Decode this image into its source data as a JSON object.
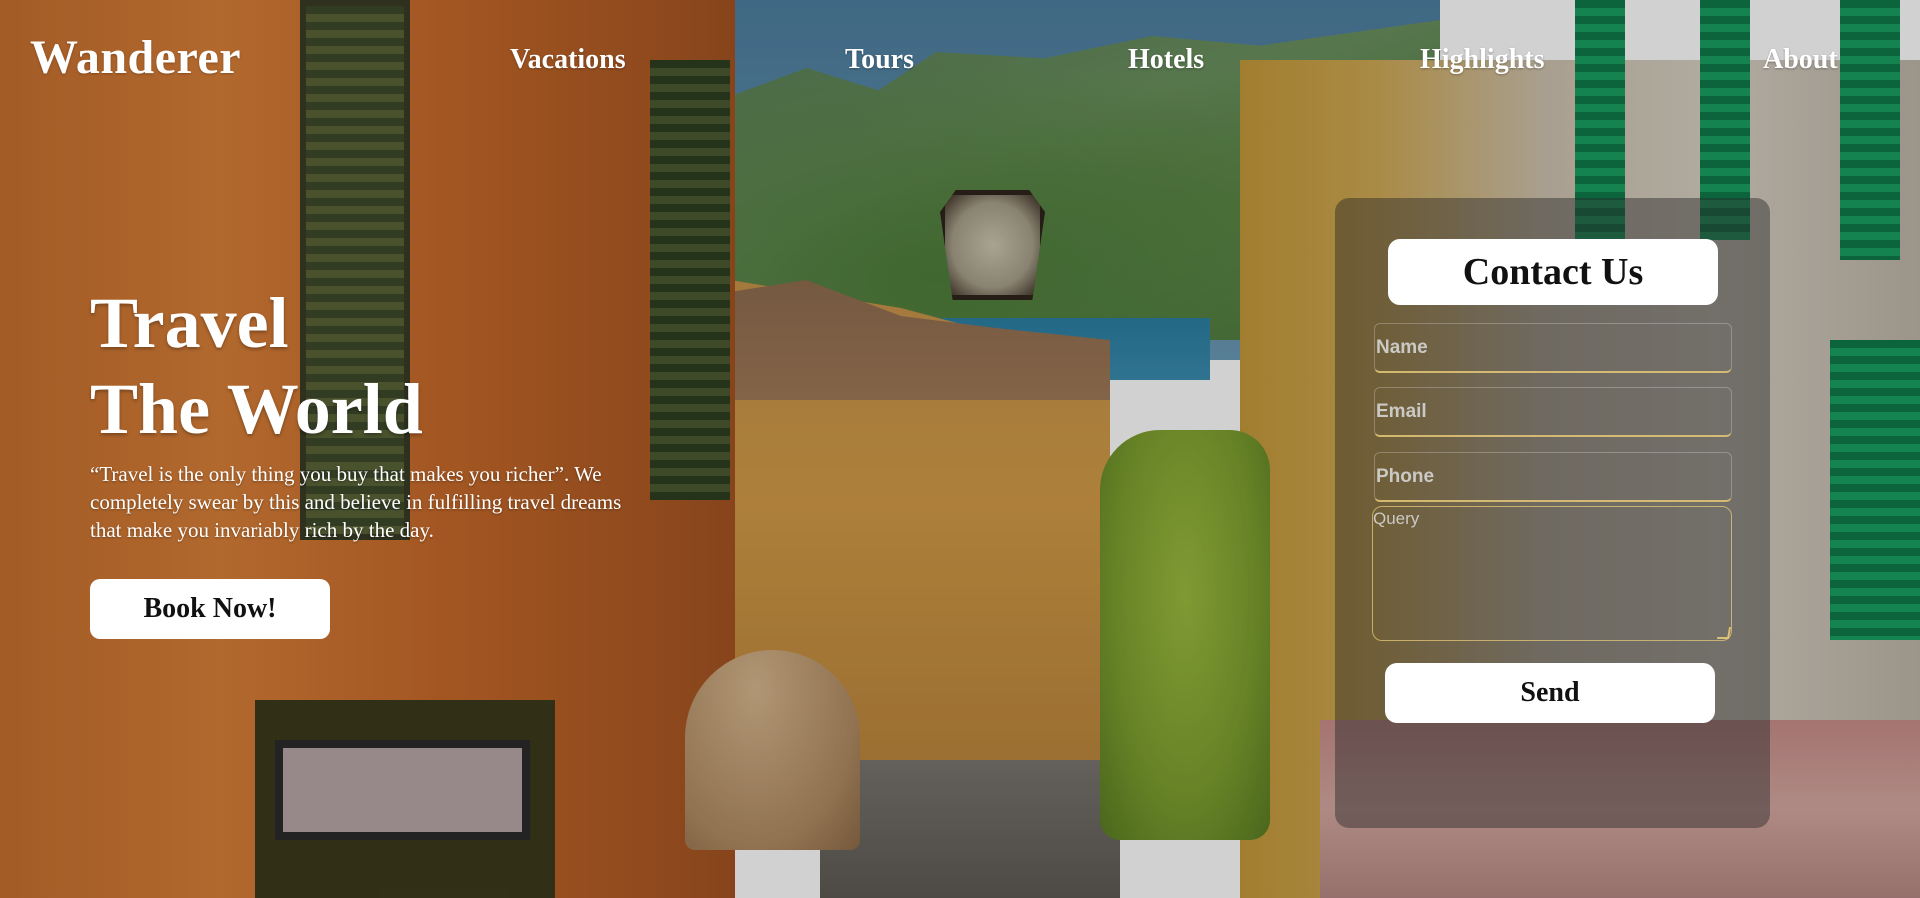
{
  "header": {
    "logo": "Wanderer",
    "nav": [
      {
        "label": "Vacations"
      },
      {
        "label": "Tours"
      },
      {
        "label": "Hotels"
      },
      {
        "label": "Highlights"
      },
      {
        "label": "About"
      }
    ]
  },
  "hero": {
    "title_line1": "Travel",
    "title_line2": "The World",
    "description": "“Travel is the only thing you buy that makes you richer”. We completely swear by this and believe in fulfilling travel dreams that make you invariably rich by the day.",
    "cta_label": "Book Now!"
  },
  "contact": {
    "title": "Contact Us",
    "name_placeholder": "Name",
    "email_placeholder": "Email",
    "phone_placeholder": "Phone",
    "query_placeholder": "Query",
    "send_label": "Send"
  },
  "colors": {
    "text": "#ffffff",
    "button_bg": "#ffffff",
    "button_text": "#111111",
    "field_accent": "#e6c878",
    "panel_bg": "rgba(40,40,40,0.45)"
  }
}
